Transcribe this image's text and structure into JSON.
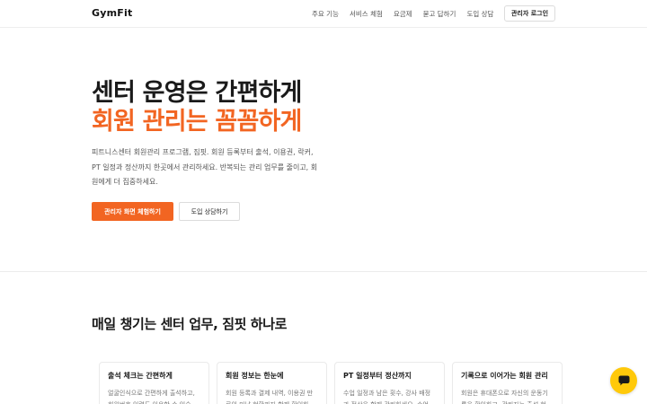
{
  "nav": {
    "logo": "GymFit",
    "menu": [
      "주요 기능",
      "서비스 체험",
      "요금제",
      "묻고 답하기",
      "도입 상담"
    ],
    "login_label": "관리자 로그인"
  },
  "hero": {
    "title_line1": "센터 운영은 간편하게",
    "title_line2": "회원 관리는 꼼꼼하게",
    "description": "피트니스센터 회원관리 프로그램, 짐핏. 회원 등록부터 출석, 이용권, 락커, PT 일정과 정산까지 한곳에서 관리하세요. 반복되는 관리 업무를 줄이고, 회원에게 더 집중하세요.",
    "cta_primary": "관리자 화면 체험하기",
    "cta_secondary": "도입 상담하기"
  },
  "features": {
    "title": "매일 챙기는 센터 업무, 짐핏 하나로",
    "cards": [
      {
        "title": "출석 체크는 간편하게",
        "desc": "얼굴인식으로 간편하게 출석하고, 회원번호 입력도 이용할 수 있습"
      },
      {
        "title": "회원 정보는 한눈에",
        "desc": "회원 등록과 결제 내역, 이용권 만료와 미납 현황까지 함께 확인하"
      },
      {
        "title": "PT 일정부터 정산까지",
        "desc": "수업 일정과 남은 횟수, 강사 배정과 정산을 함께 관리하세요. 수업"
      },
      {
        "title": "기록으로 이어가는 회원 관리",
        "desc": "회원은 휴대폰으로 자신의 운동기록을 확인하고, 관리자는 출석 현"
      }
    ]
  },
  "colors": {
    "accent": "#f26522",
    "chat": "#ffc90a"
  },
  "icons": {
    "chat": "chat-bubble-icon"
  }
}
